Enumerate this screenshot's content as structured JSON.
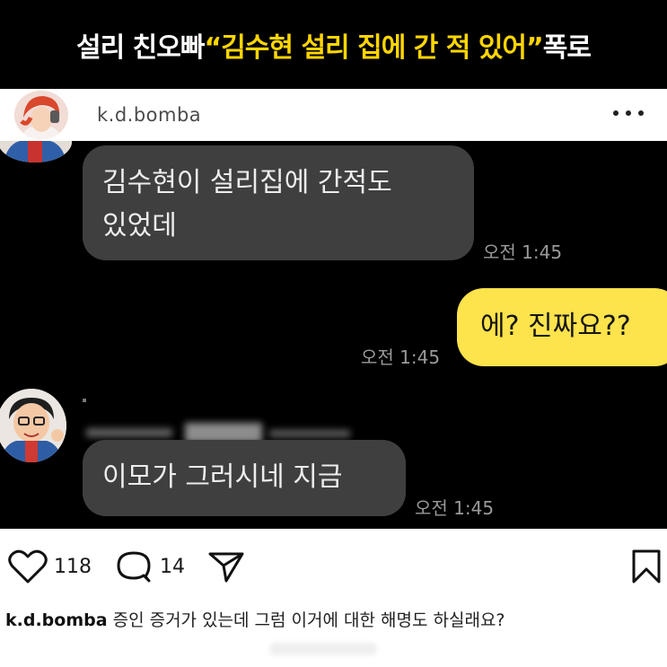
{
  "headline": {
    "prefix": "설리 친오빠 ",
    "highlight": "“김수현 설리 집에 간 적 있어”",
    "suffix": " 폭로"
  },
  "post": {
    "username": "k.d.bomba",
    "more_icon": "more-dots-icon"
  },
  "chat": {
    "messages": [
      {
        "text_line1": "김수현이 설리집에 간적도",
        "text_line2": "있었데",
        "time": "오전 1:45"
      },
      {
        "text": "에? 진짜요??",
        "time": "오전 1:45"
      },
      {
        "text": "이모가 그러시네 지금",
        "time": "오전 1:45"
      }
    ]
  },
  "actions": {
    "likes": "118",
    "comments": "14",
    "icons": [
      "heart-icon",
      "comment-icon",
      "share-icon",
      "bookmark-icon"
    ]
  },
  "caption": {
    "user": "k.d.bomba",
    "text": " 증인 증거가 있는데 그럼 이거에 대한 해명도 하실래요?"
  },
  "colors": {
    "headline_yellow": "#ffd600",
    "bubble_yellow": "#fde34c",
    "bubble_gray": "#3f3f3f"
  }
}
